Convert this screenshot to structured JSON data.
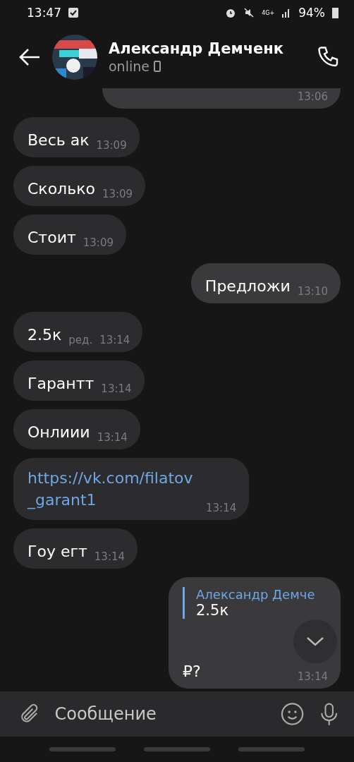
{
  "status_bar": {
    "time": "13:47",
    "network": "4G+",
    "battery": "94%"
  },
  "header": {
    "name": "Александр Демченк",
    "status": "online"
  },
  "messages": [
    {
      "kind": "hidden",
      "outgoing": true,
      "time": "13:06"
    },
    {
      "kind": "text",
      "outgoing": false,
      "text": "Весь ак",
      "time": "13:09"
    },
    {
      "kind": "text",
      "outgoing": false,
      "text": "Сколько",
      "time": "13:09"
    },
    {
      "kind": "text",
      "outgoing": false,
      "text": "Стоит",
      "time": "13:09"
    },
    {
      "kind": "text",
      "outgoing": true,
      "text": "Предложи",
      "time": "13:10"
    },
    {
      "kind": "text",
      "outgoing": false,
      "text": "2.5к",
      "edited": "ред.",
      "time": "13:14"
    },
    {
      "kind": "text",
      "outgoing": false,
      "text": "Гарантт",
      "time": "13:14"
    },
    {
      "kind": "text",
      "outgoing": false,
      "text": "Онлиии",
      "time": "13:14"
    },
    {
      "kind": "link",
      "outgoing": false,
      "text": "https://vk.com/filatov_garant1",
      "time": "13:14"
    },
    {
      "kind": "text",
      "outgoing": false,
      "text": "Гоу егт",
      "time": "13:14"
    },
    {
      "kind": "reply",
      "outgoing": true,
      "quote_author": "Александр Демче",
      "quote_text": "2.5к",
      "text": "₽?",
      "time": "13:14"
    }
  ],
  "composer": {
    "placeholder": "Сообщение"
  }
}
